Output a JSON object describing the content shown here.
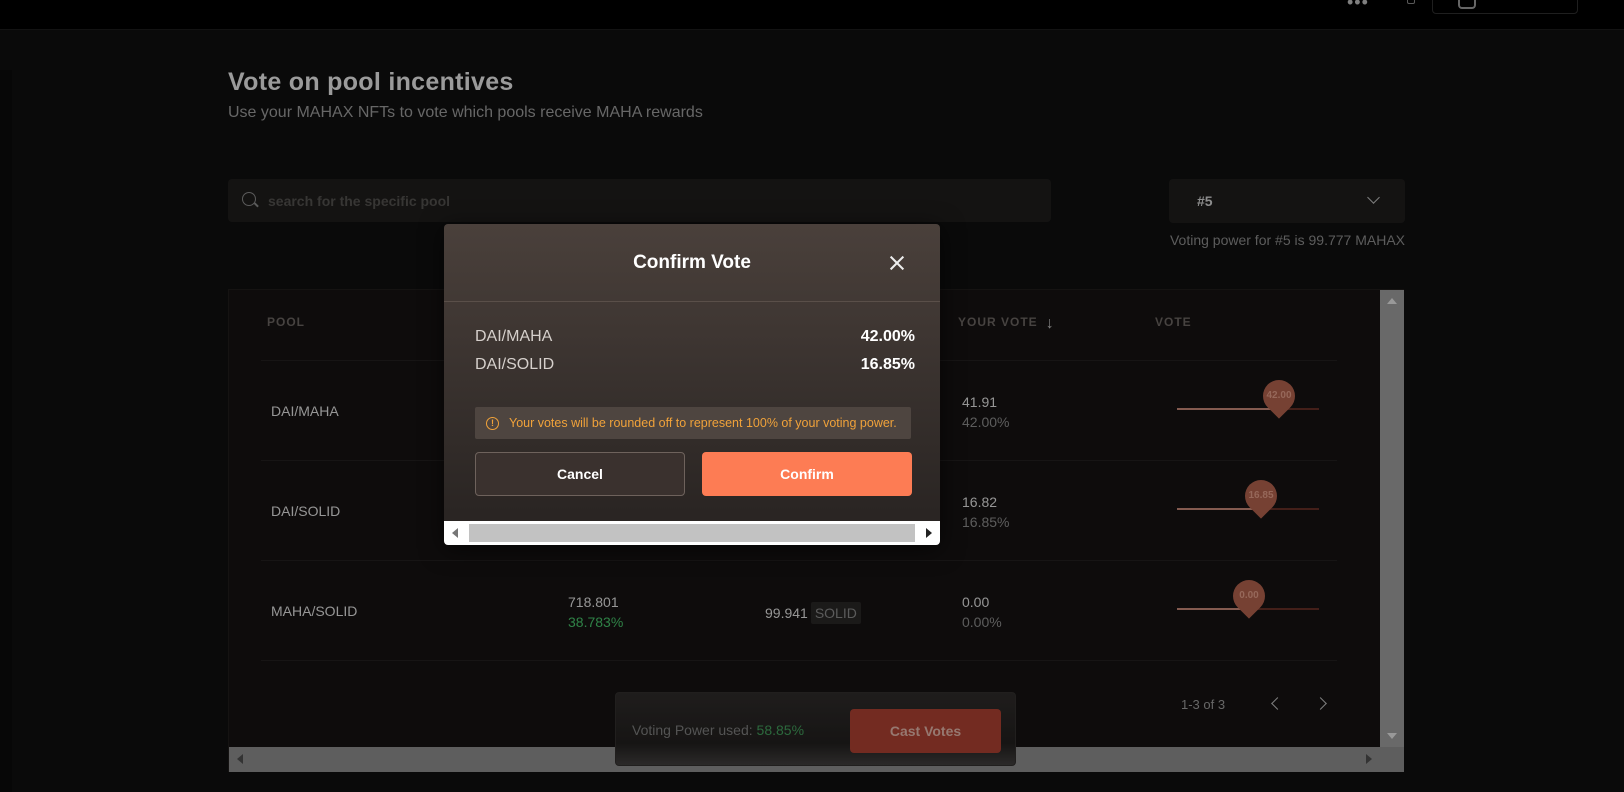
{
  "header": {
    "title": "Vote on pool incentives",
    "subtitle": "Use your MAHAX NFTs to vote which pools receive MAHA rewards"
  },
  "search": {
    "placeholder": "search for the specific pool"
  },
  "nft_select": {
    "selected": "#5"
  },
  "voting_power_note": "Voting power for #5 is  99.777 MAHAX",
  "table": {
    "columns": {
      "pool": "POOL",
      "your_vote": "YOUR VOTE",
      "vote": "VOTE"
    },
    "rows": [
      {
        "pool": "DAI/MAHA",
        "your_vote_amount": "41.91",
        "your_vote_pct": "42.00%",
        "slider_label": "42.00",
        "slider_value": 42.0
      },
      {
        "pool": "DAI/SOLID",
        "your_vote_amount": "16.82",
        "your_vote_pct": "16.85%",
        "slider_label": "16.85",
        "slider_value": 16.85
      },
      {
        "pool": "MAHA/SOLID",
        "total_votes": "718.801",
        "total_votes_pct": "38.783%",
        "rewards_amount": "99.941",
        "rewards_token": "SOLID",
        "your_vote_amount": "0.00",
        "your_vote_pct": "0.00%",
        "slider_label": "0.00",
        "slider_value": 0.0
      }
    ],
    "pagination": "1-3 of 3"
  },
  "cast_bar": {
    "label": "Voting Power used: ",
    "used_pct": "58.85%",
    "button": "Cast Votes"
  },
  "modal": {
    "title": "Confirm Vote",
    "votes": [
      {
        "pool": "DAI/MAHA",
        "pct": "42.00%"
      },
      {
        "pool": "DAI/SOLID",
        "pct": "16.85%"
      }
    ],
    "warning": "Your votes will be rounded off to represent 100% of your voting power.",
    "cancel_label": "Cancel",
    "confirm_label": "Confirm"
  },
  "colors": {
    "accent": "#fd7c54",
    "positive": "#3fae5f",
    "warning": "#f0a23a"
  },
  "icons": [
    "search-icon",
    "chevron-down-icon",
    "sort-arrow-down-icon",
    "chevron-left-icon",
    "chevron-right-icon",
    "close-icon",
    "info-icon"
  ]
}
